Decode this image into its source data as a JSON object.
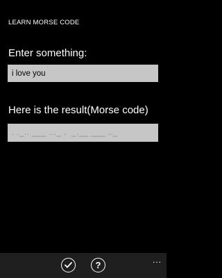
{
  "app": {
    "title": "LEARN MORSE CODE"
  },
  "input": {
    "label": "Enter something:",
    "value": "i love you"
  },
  "result": {
    "label": "Here is the result(Morse code)",
    "value": ". ._.. ___ ..._ .  _.__ ___ .._"
  },
  "appbar": {
    "buttons": [
      {
        "icon": "check-icon"
      },
      {
        "icon": "help-icon",
        "glyph": "?"
      }
    ],
    "more": "..."
  }
}
